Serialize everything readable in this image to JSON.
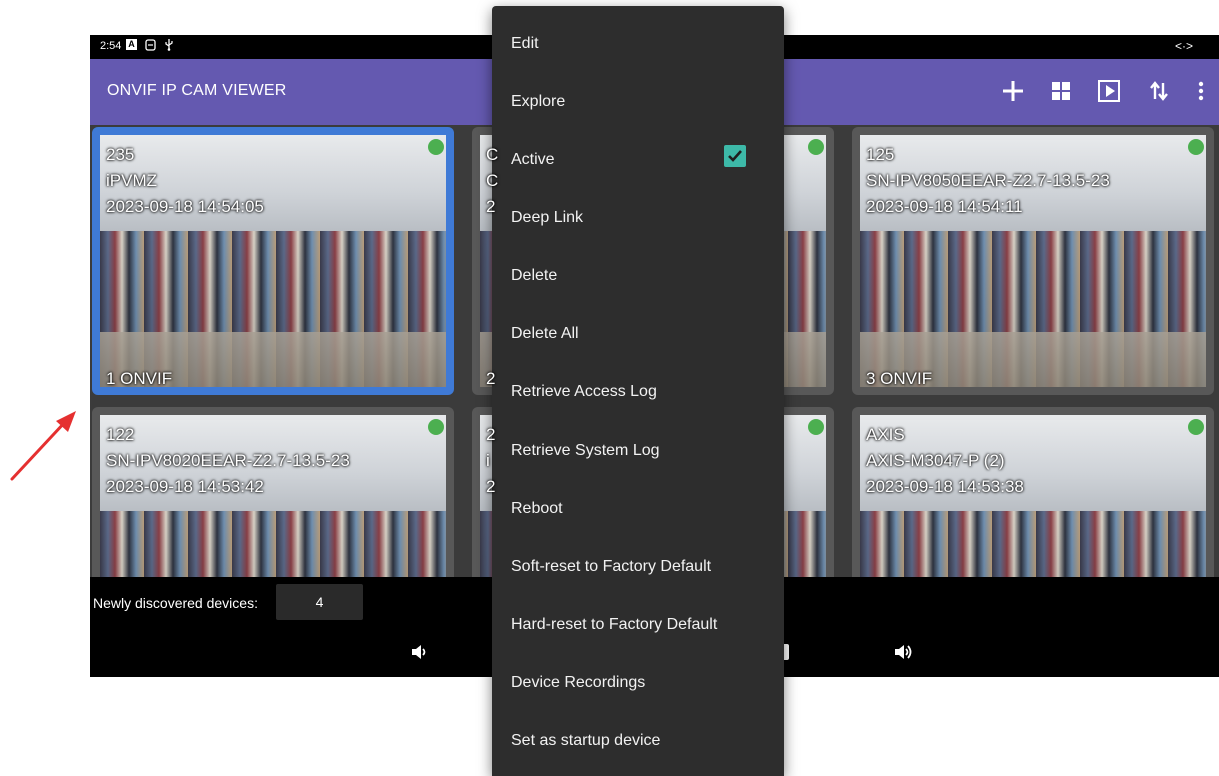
{
  "statusbar": {
    "time": "2:54",
    "a_icon": "A",
    "right_icon": "<·>"
  },
  "appbar": {
    "title": "ONVIF IP CAM VIEWER",
    "actions": [
      "add-icon",
      "grid-layout-icon",
      "play-icon",
      "sort-icon",
      "more-vert-icon"
    ]
  },
  "tiles": [
    {
      "id": "235",
      "name": "iPVMZ",
      "timestamp": "2023-09-18 14:54:05",
      "footer": "1 ONVIF",
      "selected": true
    },
    {
      "id": "C",
      "name": "C",
      "timestamp": "2",
      "footer": "2"
    },
    {
      "id": "125",
      "name": "SN-IPV8050EEAR-Z2.7-13.5-23",
      "timestamp": "2023-09-18 14:54:11",
      "footer": "3 ONVIF"
    },
    {
      "id": "122",
      "name": "SN-IPV8020EEAR-Z2.7-13.5-23",
      "timestamp": "2023-09-18 14:53:42",
      "footer": ""
    },
    {
      "id": "2",
      "name": "i",
      "timestamp": "2",
      "footer": ""
    },
    {
      "id": "AXIS",
      "name": "AXIS-M3047-P (2)",
      "timestamp": "2023-09-18 14:53:38",
      "footer": ""
    }
  ],
  "bottom": {
    "newly_discovered_label": "Newly discovered devices:",
    "newly_discovered_count": "4"
  },
  "menu": {
    "items": [
      {
        "label": "Edit"
      },
      {
        "label": "Explore"
      },
      {
        "label": "Active",
        "checked": true
      },
      {
        "label": "Deep Link"
      },
      {
        "label": "Delete"
      },
      {
        "label": "Delete All"
      },
      {
        "label": "Retrieve Access Log"
      },
      {
        "label": "Retrieve System Log"
      },
      {
        "label": "Reboot"
      },
      {
        "label": "Soft-reset to Factory Default"
      },
      {
        "label": "Hard-reset to Factory Default"
      },
      {
        "label": "Device Recordings"
      },
      {
        "label": "Set as startup device"
      }
    ]
  },
  "colors": {
    "appbar": "#6459b0",
    "accent_check": "#3db9a8",
    "online_dot": "#4caf50",
    "selection": "#3f7ad6",
    "annotation_arrow": "#e53030"
  }
}
